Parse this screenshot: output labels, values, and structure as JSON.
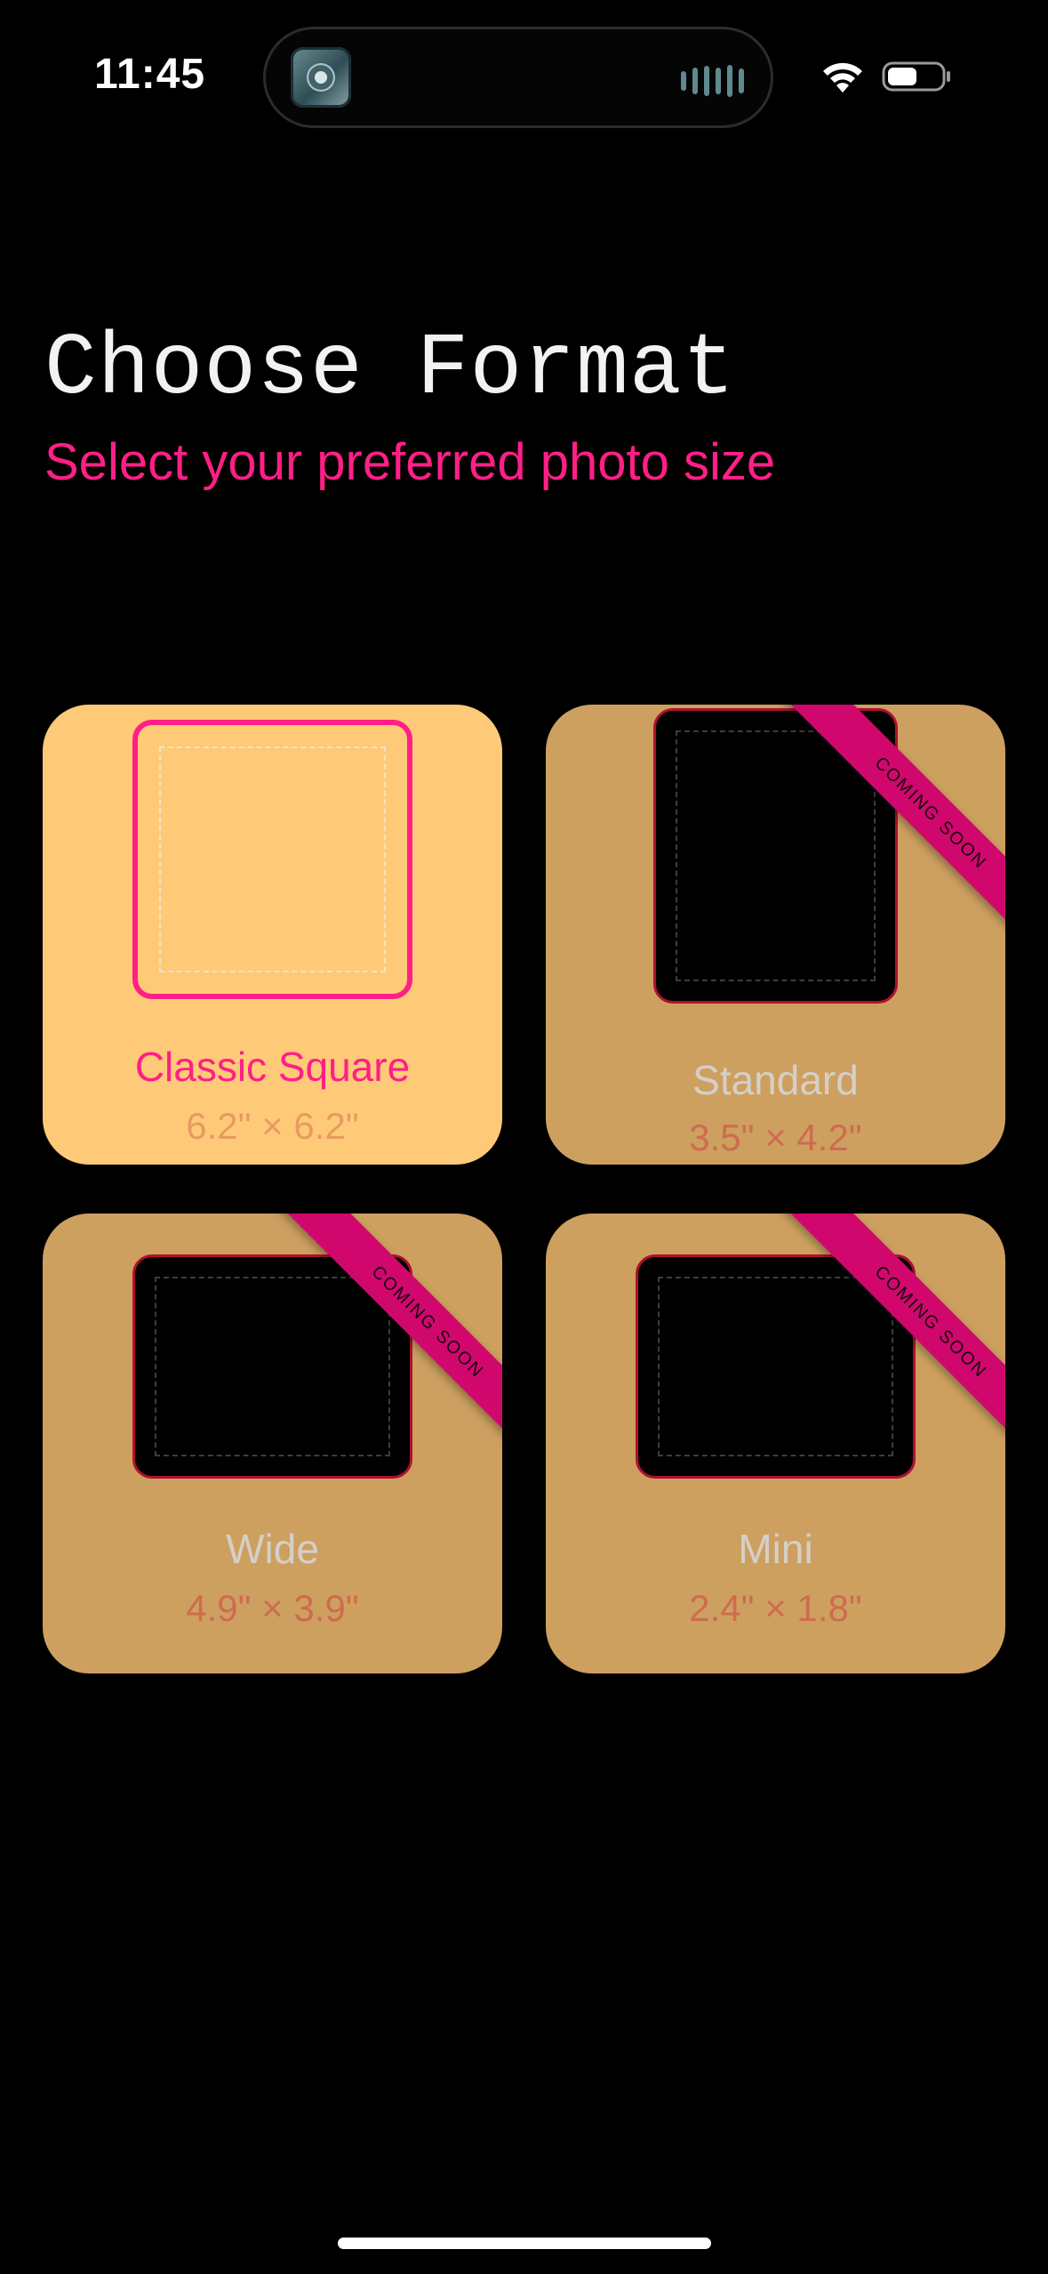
{
  "status_bar": {
    "time": "11:45"
  },
  "header": {
    "title": "Choose Format",
    "subtitle": "Select your preferred photo size"
  },
  "formats": [
    {
      "name": "Classic Square",
      "size": "6.2\" × 6.2\"",
      "selected": true,
      "badge": ""
    },
    {
      "name": "Standard",
      "size": "3.5\" × 4.2\"",
      "selected": false,
      "badge": "COMING SOON"
    },
    {
      "name": "Wide",
      "size": "4.9\" × 3.9\"",
      "selected": false,
      "badge": "COMING SOON"
    },
    {
      "name": "Mini",
      "size": "2.4\" × 1.8\"",
      "selected": false,
      "badge": "COMING SOON"
    }
  ],
  "colors": {
    "background": "#000000",
    "accent_pink": "#ff1f86",
    "card_selected": "#ffca78",
    "card_default": "#cda060",
    "ribbon": "#d0086d"
  },
  "icons": [
    "wifi-icon",
    "battery-icon",
    "now-playing-app-icon",
    "audio-waveform-icon"
  ]
}
